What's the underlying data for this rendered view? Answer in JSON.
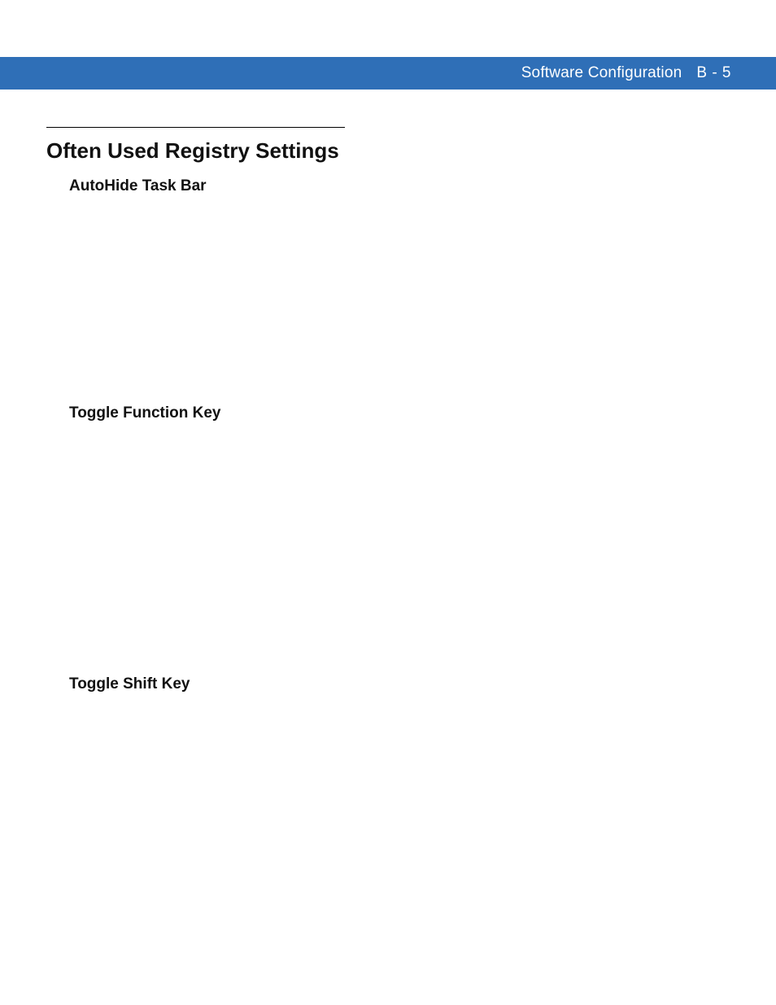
{
  "header": {
    "title": "Software Configuration",
    "page": "B - 5"
  },
  "section": {
    "title": "Often Used Registry Settings",
    "subsections": [
      {
        "heading": "AutoHide Task Bar"
      },
      {
        "heading": "Toggle Function Key"
      },
      {
        "heading": "Toggle Shift Key"
      }
    ]
  }
}
